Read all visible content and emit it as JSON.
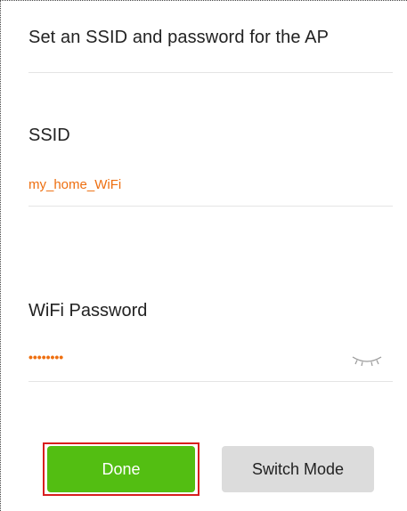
{
  "header": {
    "title": "Set an SSID and password for the AP"
  },
  "ssid": {
    "label": "SSID",
    "value": "my_home_WiFi"
  },
  "password": {
    "label": "WiFi Password",
    "value": "••••••••",
    "visibility_icon": "eye-closed-icon"
  },
  "buttons": {
    "done_label": "Done",
    "switch_mode_label": "Switch Mode"
  },
  "colors": {
    "accent": "#ee6f10",
    "primary_button": "#53be12",
    "secondary_button": "#dcdcdc",
    "highlight_border": "#d81e1e"
  }
}
